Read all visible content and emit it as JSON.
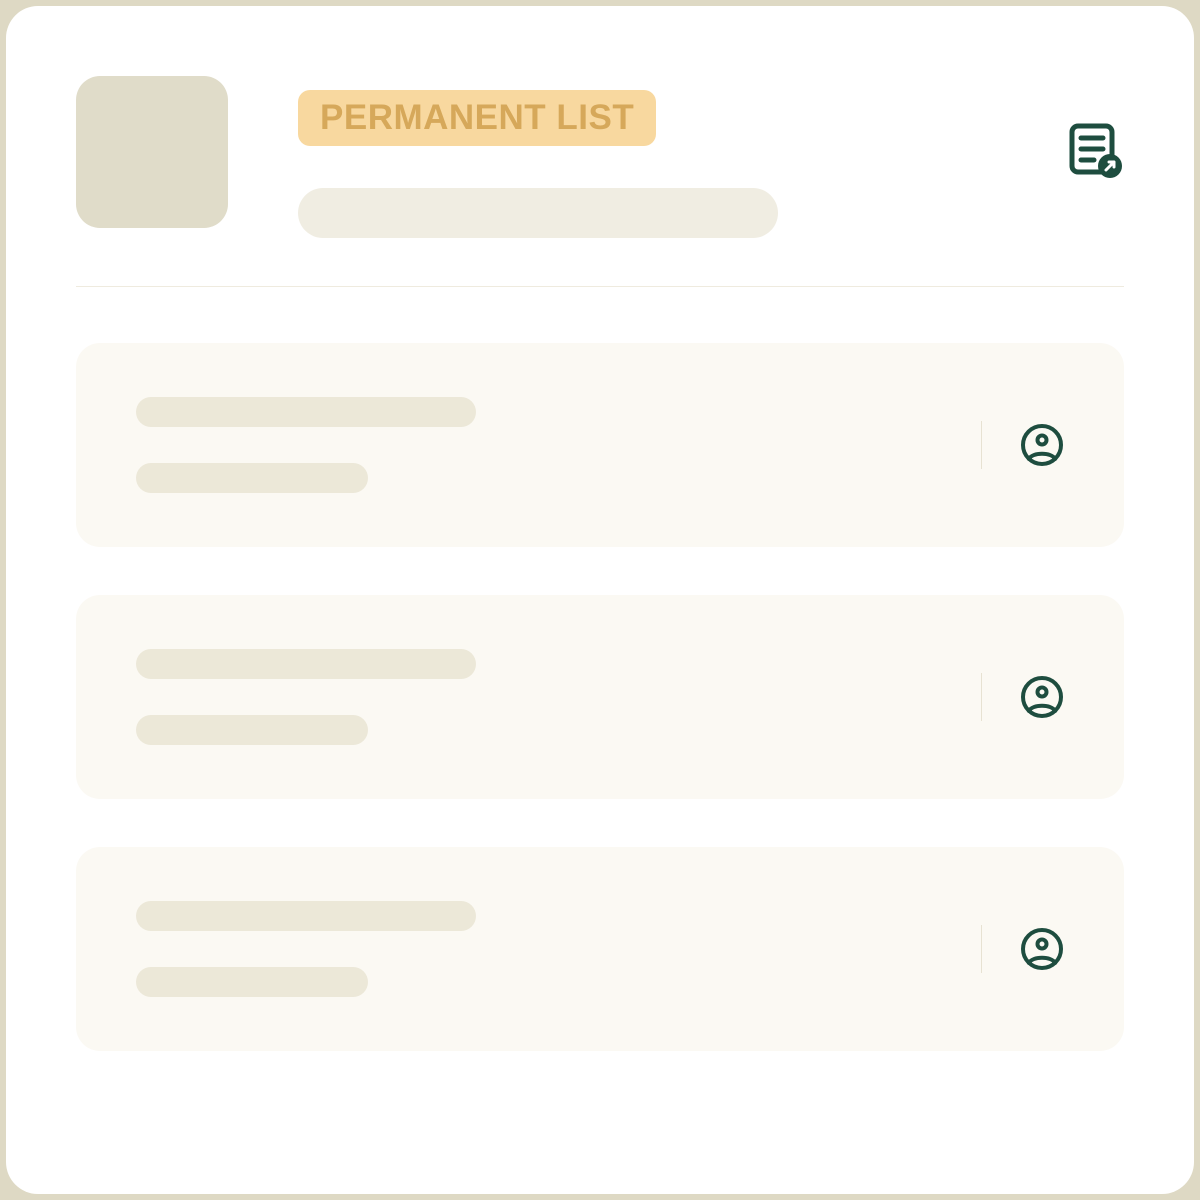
{
  "badge": {
    "label": "PERMANENT LIST"
  },
  "colors": {
    "icon_dark": "#1E4D3F",
    "badge_bg": "#F8D89F",
    "badge_fg": "#D6A85A"
  },
  "header_icon": "document-share-icon",
  "items": [
    {
      "icon": "user-circle-icon"
    },
    {
      "icon": "user-circle-icon"
    },
    {
      "icon": "user-circle-icon"
    }
  ]
}
